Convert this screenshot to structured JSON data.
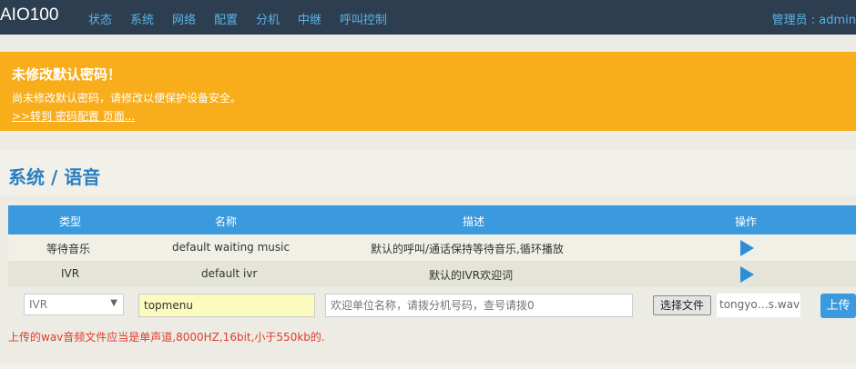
{
  "app": {
    "brand": "AIO100",
    "nav": [
      "状态",
      "系统",
      "网络",
      "配置",
      "分机",
      "中继",
      "呼叫控制"
    ],
    "admin": "管理员 : admin"
  },
  "alert": {
    "title": "未修改默认密码！",
    "text": "尚未修改默认密码，请修改以便保护设备安全。",
    "link": ">>转到 密码配置 页面..."
  },
  "page": {
    "title": "系统 / 语音"
  },
  "table": {
    "headers": [
      "类型",
      "名称",
      "描述",
      "操作"
    ],
    "rows": [
      {
        "type": "等待音乐",
        "name": "default waiting music",
        "desc": "默认的呼叫/通话保持等待音乐,循环播放"
      },
      {
        "type": "IVR",
        "name": "default ivr",
        "desc": "默认的IVR欢迎词"
      }
    ]
  },
  "form": {
    "type_value": "IVR",
    "name_value": "topmenu",
    "desc_placeholder": "欢迎单位名称，请拨分机号码，查号请拨0",
    "file_button": "选择文件",
    "file_name": "tongyo…s.wav",
    "upload_button": "上传"
  },
  "hint": "上传的wav音频文件应当是单声道,8000HZ,16bit,小于550kb的.",
  "colors": {
    "topbar": "#2d3e50",
    "accent": "#3a9add",
    "alert": "#f8ad1b",
    "error": "#e03b2e"
  }
}
